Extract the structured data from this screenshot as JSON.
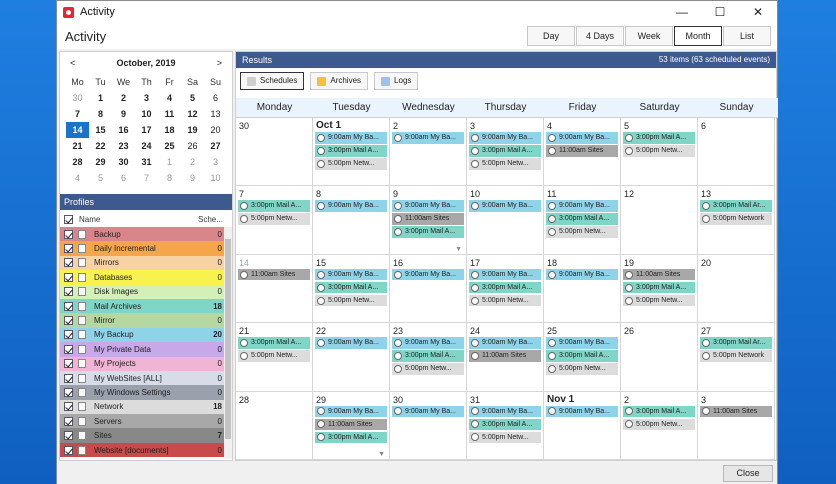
{
  "window": {
    "title": "Activity",
    "controls": [
      "—",
      "☐",
      "✕"
    ]
  },
  "header": {
    "page_title": "Activity"
  },
  "view_tabs": [
    "Day",
    "4 Days",
    "Week",
    "Month",
    "List"
  ],
  "active_view": "Month",
  "mini_calendar": {
    "title": "October, 2019",
    "prev": "<",
    "next": ">",
    "dow": [
      "Mo",
      "Tu",
      "We",
      "Th",
      "Fr",
      "Sa",
      "Su"
    ],
    "days": [
      [
        "30",
        "dim"
      ],
      [
        "1",
        "bold"
      ],
      [
        "2",
        "bold"
      ],
      [
        "3",
        "bold"
      ],
      [
        "4",
        "bold"
      ],
      [
        "5",
        "bold"
      ],
      [
        "6",
        ""
      ],
      [
        "7",
        "bold"
      ],
      [
        "8",
        "bold"
      ],
      [
        "9",
        "bold"
      ],
      [
        "10",
        "bold"
      ],
      [
        "11",
        "bold"
      ],
      [
        "12",
        "bold"
      ],
      [
        "13",
        ""
      ],
      [
        "14",
        "sel"
      ],
      [
        "15",
        "bold"
      ],
      [
        "16",
        "bold"
      ],
      [
        "17",
        "bold"
      ],
      [
        "18",
        "bold"
      ],
      [
        "19",
        "bold"
      ],
      [
        "20",
        ""
      ],
      [
        "21",
        "bold"
      ],
      [
        "22",
        "bold"
      ],
      [
        "23",
        "bold"
      ],
      [
        "24",
        "bold"
      ],
      [
        "25",
        "bold"
      ],
      [
        "26",
        ""
      ],
      [
        "27",
        "bold"
      ],
      [
        "28",
        "bold"
      ],
      [
        "29",
        "bold"
      ],
      [
        "30",
        "bold"
      ],
      [
        "31",
        "bold"
      ],
      [
        "1",
        "dim"
      ],
      [
        "2",
        "dim"
      ],
      [
        "3",
        "dim"
      ],
      [
        "4",
        "dim"
      ],
      [
        "5",
        "dim"
      ],
      [
        "6",
        "dim"
      ],
      [
        "7",
        "dim"
      ],
      [
        "8",
        "dim"
      ],
      [
        "9",
        "dim"
      ],
      [
        "10",
        "dim"
      ]
    ]
  },
  "profiles": {
    "title": "Profiles",
    "col_name": "Name",
    "col_sched": "Sche...",
    "items": [
      {
        "name": "Backup",
        "count": "0",
        "color": "#d9868b"
      },
      {
        "name": "Daily Incremental",
        "count": "0",
        "color": "#f5a64a"
      },
      {
        "name": "Mirrors",
        "count": "0",
        "color": "#f7d3a3"
      },
      {
        "name": "Databases",
        "count": "0",
        "color": "#f8f24e"
      },
      {
        "name": "Disk Images",
        "count": "0",
        "color": "#d3f0b7"
      },
      {
        "name": "Mail Archives",
        "count": "18",
        "color": "#7fd6c6"
      },
      {
        "name": "Mirror",
        "count": "0",
        "color": "#b5d7a1"
      },
      {
        "name": "My Backup",
        "count": "20",
        "color": "#8fd3e8"
      },
      {
        "name": "My Private Data",
        "count": "0",
        "color": "#c8a8e8"
      },
      {
        "name": "My Projects",
        "count": "0",
        "color": "#f0b4d4"
      },
      {
        "name": "My WebSites [ALL]",
        "count": "0",
        "color": "#d8dce8"
      },
      {
        "name": "My Windows Settings",
        "count": "0",
        "color": "#9aa0ac"
      },
      {
        "name": "Network",
        "count": "18",
        "color": "#dcdcdc"
      },
      {
        "name": "Servers",
        "count": "0",
        "color": "#a8a8a8"
      },
      {
        "name": "Sites",
        "count": "7",
        "color": "#888888"
      },
      {
        "name": "Website [documents]",
        "count": "0",
        "color": "#c94a4a"
      }
    ]
  },
  "results": {
    "title": "Results",
    "count": "53 items (63 scheduled events)",
    "tabs": [
      "Schedules",
      "Archives",
      "Logs"
    ]
  },
  "month": {
    "dow": [
      "Monday",
      "Tuesday",
      "Wednesday",
      "Thursday",
      "Friday",
      "Saturday",
      "Sunday"
    ],
    "days": [
      {
        "n": "30",
        "cls": "",
        "ev": []
      },
      {
        "n": "Oct 1",
        "cls": "bold",
        "ev": [
          [
            "9:00am My Ba...",
            "backup"
          ],
          [
            "3:00pm Mail A...",
            "mail"
          ],
          [
            "5:00pm Netw...",
            "net"
          ]
        ]
      },
      {
        "n": "2",
        "cls": "",
        "ev": [
          [
            "9:00am My Ba...",
            "backup"
          ]
        ]
      },
      {
        "n": "3",
        "cls": "",
        "ev": [
          [
            "9:00am My Ba...",
            "backup"
          ],
          [
            "3:00pm Mail A...",
            "mail"
          ],
          [
            "5:00pm Netw...",
            "net"
          ]
        ]
      },
      {
        "n": "4",
        "cls": "",
        "ev": [
          [
            "9:00am My Ba...",
            "backup"
          ],
          [
            "11:00am Sites",
            "sites"
          ]
        ]
      },
      {
        "n": "5",
        "cls": "",
        "ev": [
          [
            "3:00pm Mail A...",
            "mail"
          ],
          [
            "5:00pm Netw...",
            "net"
          ]
        ]
      },
      {
        "n": "6",
        "cls": "",
        "ev": []
      },
      {
        "n": "7",
        "cls": "",
        "ev": [
          [
            "3:00pm Mail A...",
            "mail"
          ],
          [
            "5:00pm Netw...",
            "net"
          ]
        ]
      },
      {
        "n": "8",
        "cls": "",
        "ev": [
          [
            "9:00am My Ba...",
            "backup"
          ]
        ]
      },
      {
        "n": "9",
        "cls": "",
        "ev": [
          [
            "9:00am My Ba...",
            "backup"
          ],
          [
            "11:00am Sites",
            "sites"
          ],
          [
            "3:00pm Mail A...",
            "mail"
          ]
        ],
        "more": "▼"
      },
      {
        "n": "10",
        "cls": "",
        "ev": [
          [
            "9:00am My Ba...",
            "backup"
          ]
        ]
      },
      {
        "n": "11",
        "cls": "",
        "ev": [
          [
            "9:00am My Ba...",
            "backup"
          ],
          [
            "3:00pm Mail A...",
            "mail"
          ],
          [
            "5:00pm Netw...",
            "net"
          ]
        ]
      },
      {
        "n": "12",
        "cls": "",
        "ev": []
      },
      {
        "n": "13",
        "cls": "",
        "ev": [
          [
            "3:00pm Mail Ar...",
            "mail"
          ],
          [
            "5:00pm Network",
            "net"
          ]
        ]
      },
      {
        "n": "14",
        "cls": "faded",
        "ev": [
          [
            "11:00am Sites",
            "sites"
          ]
        ]
      },
      {
        "n": "15",
        "cls": "",
        "ev": [
          [
            "9:00am My Ba...",
            "backup"
          ],
          [
            "3:00pm Mail A...",
            "mail"
          ],
          [
            "5:00pm Netw...",
            "net"
          ]
        ]
      },
      {
        "n": "16",
        "cls": "",
        "ev": [
          [
            "9:00am My Ba...",
            "backup"
          ]
        ]
      },
      {
        "n": "17",
        "cls": "",
        "ev": [
          [
            "9:00am My Ba...",
            "backup"
          ],
          [
            "3:00pm Mail A...",
            "mail"
          ],
          [
            "5:00pm Netw...",
            "net"
          ]
        ]
      },
      {
        "n": "18",
        "cls": "",
        "ev": [
          [
            "9:00am My Ba...",
            "backup"
          ]
        ]
      },
      {
        "n": "19",
        "cls": "",
        "ev": [
          [
            "11:00am Sites",
            "sites"
          ],
          [
            "3:00pm Mail A...",
            "mail"
          ],
          [
            "5:00pm Netw...",
            "net"
          ]
        ]
      },
      {
        "n": "20",
        "cls": "",
        "ev": []
      },
      {
        "n": "21",
        "cls": "",
        "ev": [
          [
            "3:00pm Mail A...",
            "mail"
          ],
          [
            "5:00pm Netw...",
            "net"
          ]
        ]
      },
      {
        "n": "22",
        "cls": "",
        "ev": [
          [
            "9:00am My Ba...",
            "backup"
          ]
        ]
      },
      {
        "n": "23",
        "cls": "",
        "ev": [
          [
            "9:00am My Ba...",
            "backup"
          ],
          [
            "3:00pm Mail A...",
            "mail"
          ],
          [
            "5:00pm Netw...",
            "net"
          ]
        ]
      },
      {
        "n": "24",
        "cls": "",
        "ev": [
          [
            "9:00am My Ba...",
            "backup"
          ],
          [
            "11:00am Sites",
            "sites"
          ]
        ]
      },
      {
        "n": "25",
        "cls": "",
        "ev": [
          [
            "9:00am My Ba...",
            "backup"
          ],
          [
            "3:00pm Mail A...",
            "mail"
          ],
          [
            "5:00pm Netw...",
            "net"
          ]
        ]
      },
      {
        "n": "26",
        "cls": "",
        "ev": []
      },
      {
        "n": "27",
        "cls": "",
        "ev": [
          [
            "3:00pm Mail Ar...",
            "mail"
          ],
          [
            "5:00pm Network",
            "net"
          ]
        ]
      },
      {
        "n": "28",
        "cls": "",
        "ev": []
      },
      {
        "n": "29",
        "cls": "",
        "ev": [
          [
            "9:00am My Ba...",
            "backup"
          ],
          [
            "11:00am Sites",
            "sites"
          ],
          [
            "3:00pm Mail A...",
            "mail"
          ]
        ],
        "more": "▼"
      },
      {
        "n": "30",
        "cls": "",
        "ev": [
          [
            "9:00am My Ba...",
            "backup"
          ]
        ]
      },
      {
        "n": "31",
        "cls": "",
        "ev": [
          [
            "9:00am My Ba...",
            "backup"
          ],
          [
            "3:00pm Mail A...",
            "mail"
          ],
          [
            "5:00pm Netw...",
            "net"
          ]
        ]
      },
      {
        "n": "Nov 1",
        "cls": "bold",
        "ev": [
          [
            "9:00am My Ba...",
            "backup"
          ]
        ]
      },
      {
        "n": "2",
        "cls": "",
        "ev": [
          [
            "3:00pm Mail A...",
            "mail"
          ],
          [
            "5:00pm Netw...",
            "net"
          ]
        ]
      },
      {
        "n": "3",
        "cls": "",
        "ev": [
          [
            "11:00am Sites",
            "sites"
          ]
        ]
      }
    ]
  },
  "footer": {
    "close_label": "Close"
  }
}
